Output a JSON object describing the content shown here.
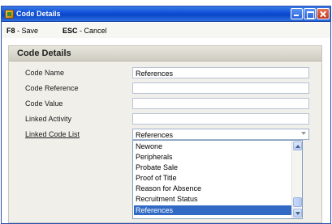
{
  "window": {
    "title": "Code Details"
  },
  "shortcuts": {
    "save_key": "F8",
    "save_label": " - Save",
    "cancel_key": "ESC",
    "cancel_label": " - Cancel"
  },
  "panel": {
    "title": "Code Details",
    "fields": {
      "code_name": {
        "label": "Code Name",
        "value": "References"
      },
      "code_reference": {
        "label": "Code Reference",
        "value": ""
      },
      "code_value": {
        "label": "Code Value",
        "value": ""
      },
      "linked_activity": {
        "label": "Linked Activity",
        "value": ""
      },
      "linked_code_list": {
        "label": "Linked Code List",
        "value": "References"
      }
    },
    "dropdown_options": [
      "Newone",
      "Peripherals",
      "Probate Sale",
      "Proof of Title",
      "Reason for Absence",
      "Recruitment Status",
      "References"
    ],
    "selected_option": "References"
  },
  "colors": {
    "titlebar": "#0f4fd6",
    "selection": "#316ac5",
    "panel_bg": "#f0efe9"
  }
}
